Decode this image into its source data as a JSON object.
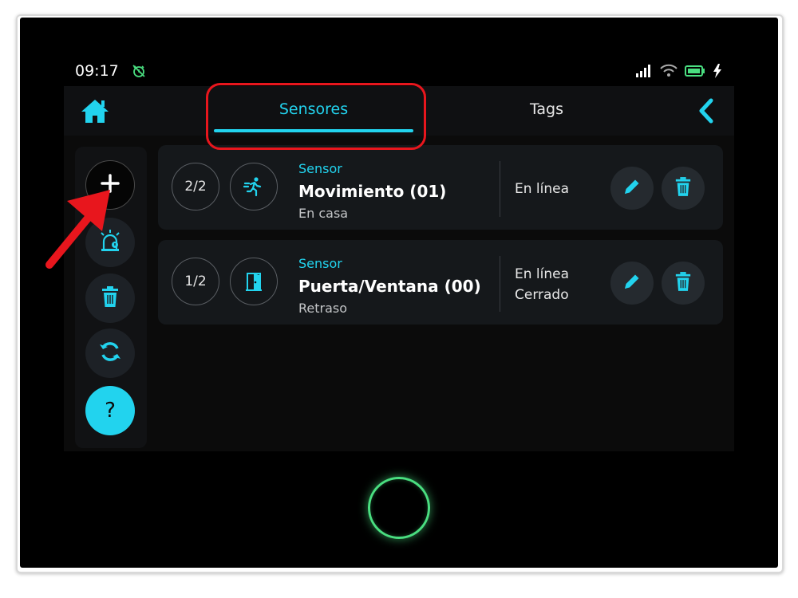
{
  "status_bar": {
    "time": "09:17",
    "icons": [
      "alarm-off-icon",
      "signal-icon",
      "wifi-icon",
      "battery-icon",
      "charging-icon"
    ]
  },
  "header": {
    "home_icon": "home-icon",
    "tabs": [
      {
        "label": "Sensores",
        "active": true
      },
      {
        "label": "Tags",
        "active": false
      }
    ],
    "back_icon": "chevron-left-icon"
  },
  "sidebar": {
    "buttons": [
      {
        "icon": "plus-icon"
      },
      {
        "icon": "siren-icon"
      },
      {
        "icon": "trash-icon"
      },
      {
        "icon": "refresh-icon"
      },
      {
        "label": "?",
        "icon": "help-icon"
      }
    ]
  },
  "sensors": [
    {
      "count": "2/2",
      "icon": "running-person-icon",
      "type": "Sensor",
      "name": "Movimiento (01)",
      "mode": "En casa",
      "status": [
        "En línea"
      ]
    },
    {
      "count": "1/2",
      "icon": "door-icon",
      "type": "Sensor",
      "name": "Puerta/Ventana (00)",
      "mode": "Retraso",
      "status": [
        "En línea",
        "Cerrado"
      ]
    }
  ],
  "colors": {
    "accent": "#22d3ee",
    "annotation": "#e8161d",
    "home_ring": "#4ade80",
    "battery": "#4ade80"
  }
}
